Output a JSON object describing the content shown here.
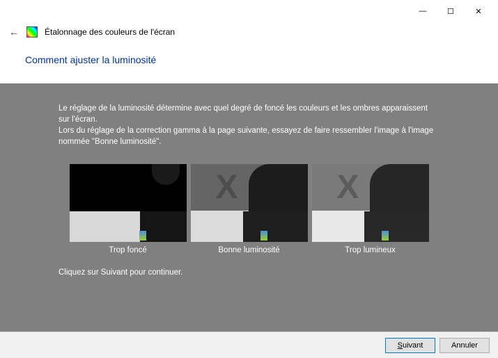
{
  "window": {
    "minimize": "—",
    "maximize": "☐",
    "close": "✕"
  },
  "header": {
    "back_icon": "←",
    "title": "Étalonnage des couleurs de l'écran"
  },
  "heading": "Comment ajuster la luminosité",
  "body": {
    "line1": "Le réglage de la luminosité détermine avec quel degré de foncé les couleurs et les ombres apparaissent sur l'écran.",
    "line2": "Lors du réglage de la correction gamma à la page suivante, essayez de faire ressembler l'image à l'image nommée \"Bonne luminosité\"."
  },
  "samples": {
    "dark_label": "Trop foncé",
    "good_label": "Bonne luminosité",
    "bright_label": "Trop lumineux"
  },
  "continue_text": "Cliquez sur Suivant pour continuer.",
  "buttons": {
    "next": "Suivant",
    "cancel": "Annuler"
  }
}
